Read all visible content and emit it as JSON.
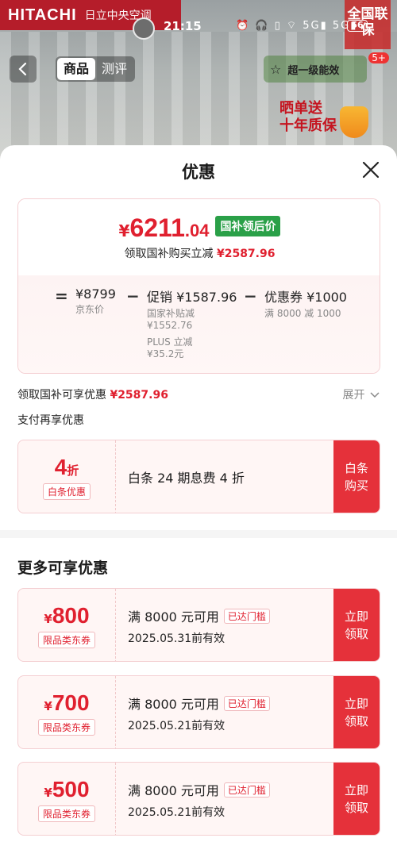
{
  "background": {
    "brand": "HITACHI",
    "brand_sub": "日立中央空调",
    "badge": "全国联保",
    "badge_count": "5+",
    "tabs": [
      "商品",
      "测评"
    ],
    "tools_label": "超一级能效",
    "promo_text": "晒单送\n十年质保"
  },
  "status_bar": {
    "time": "21:15",
    "battery": "56"
  },
  "sheet": {
    "title": "优惠",
    "price": {
      "yen": "¥",
      "integer": "6211",
      "decimal": ".04",
      "tag": "国补领后价",
      "sub_label": "领取国补购买立减",
      "sub_amount": "¥2587.96"
    },
    "breakdown": {
      "eq": "=",
      "jd_price": "¥8799",
      "jd_label": "京东价",
      "minus1": "−",
      "promo": "促销 ¥1587.96",
      "promo_sub1": "国家补贴减",
      "promo_sub1_val": "¥1552.76",
      "promo_sub2": "PLUS 立减",
      "promo_sub2_val": "¥35.2元",
      "minus2": "−",
      "coupon": "优惠券 ¥1000",
      "coupon_sub": "满 8000 减 1000"
    },
    "subsidy_row": {
      "label": "领取国补可享优惠",
      "amount": "¥2587.96"
    },
    "expand_label": "展开",
    "pay_more_title": "支付再享优惠",
    "baitiao": {
      "num": "4",
      "unit": "折",
      "chip": "白条优惠",
      "desc": "白条 24 期息费 4 折",
      "btn_line1": "白条",
      "btn_line2": "购买"
    },
    "more_title": "更多可享优惠",
    "coupons": [
      {
        "yen": "¥",
        "amount": "800",
        "chip": "限品类东券",
        "line1": "满 8000 元可用",
        "reached": "已达门槛",
        "line2": "2025.05.31前有效",
        "btn_line1": "立即",
        "btn_line2": "领取"
      },
      {
        "yen": "¥",
        "amount": "700",
        "chip": "限品类东券",
        "line1": "满 8000 元可用",
        "reached": "已达门槛",
        "line2": "2025.05.21前有效",
        "btn_line1": "立即",
        "btn_line2": "领取"
      },
      {
        "yen": "¥",
        "amount": "500",
        "chip": "限品类东券",
        "line1": "满 8000 元可用",
        "reached": "已达门槛",
        "line2": "2025.05.21前有效",
        "btn_line1": "立即",
        "btn_line2": "领取"
      }
    ]
  },
  "colors": {
    "accent_red": "#e0202f",
    "button_red": "#e5313a",
    "tag_green": "#2aa048"
  }
}
